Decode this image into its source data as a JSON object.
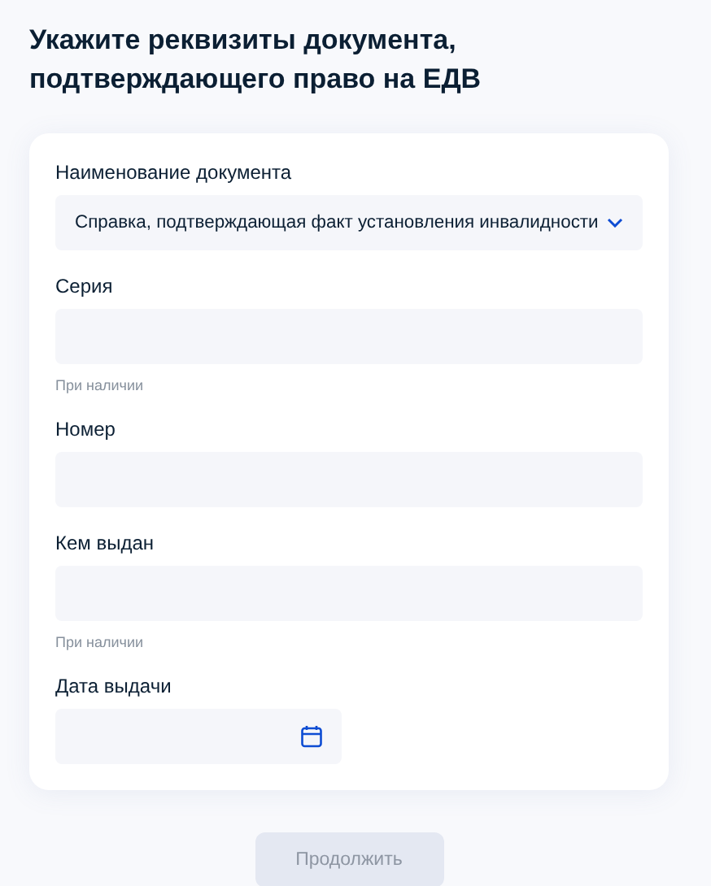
{
  "heading": "Укажите реквизиты документа, подтверждающего право на ЕДВ",
  "fields": [
    {
      "kind": "select",
      "label": "Наименование документа",
      "value": "Справка, подтверждающая факт установления инвалидности"
    },
    {
      "kind": "text",
      "label": "Серия",
      "hint": "При наличии"
    },
    {
      "kind": "text",
      "label": "Номер"
    },
    {
      "kind": "text",
      "label": "Кем выдан",
      "hint": "При наличии"
    },
    {
      "kind": "date",
      "label": "Дата выдачи"
    }
  ],
  "continue_button": {
    "label": "Продолжить",
    "disabled": true
  }
}
